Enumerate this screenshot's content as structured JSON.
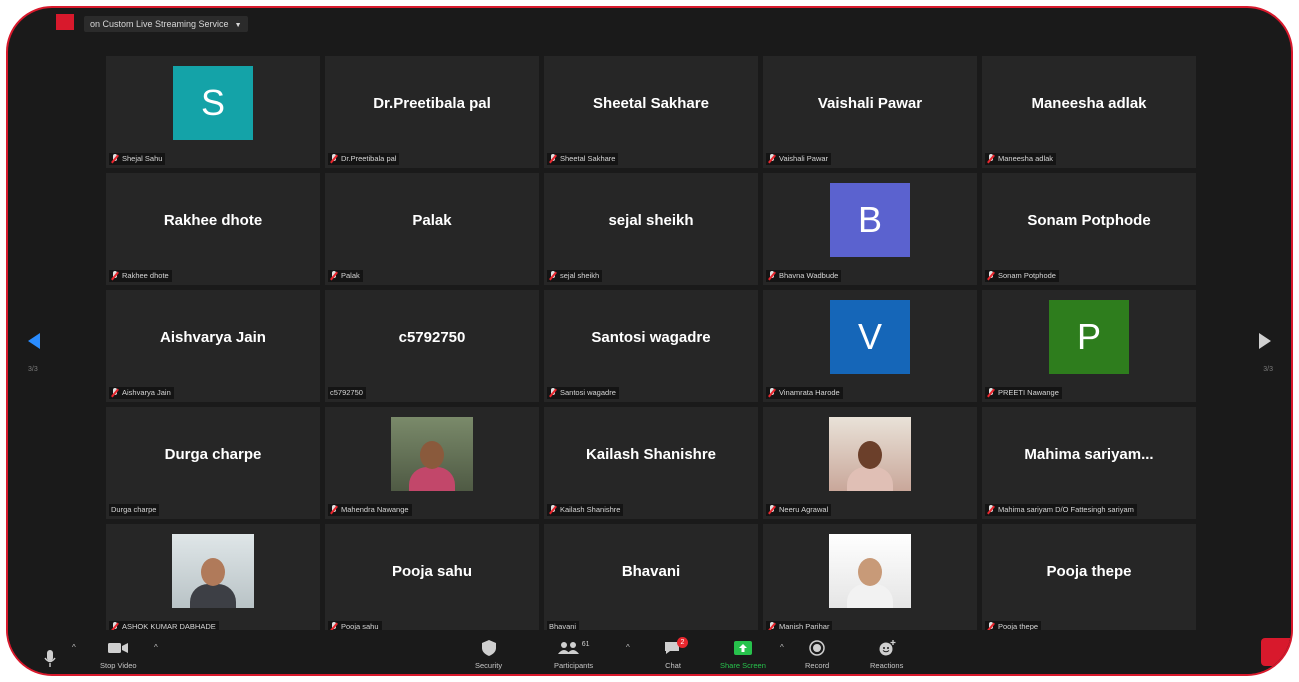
{
  "topbar": {
    "live_service": "on Custom Live Streaming Service"
  },
  "pagination": {
    "left": "3/3",
    "right": "3/3"
  },
  "tiles": [
    {
      "name": "Shejal Sahu",
      "kind": "avatar",
      "letter": "S",
      "color": "#14a3a8",
      "muted": true
    },
    {
      "name": "Dr.Preetibala pal",
      "kind": "name",
      "big": "Dr.Preetibala pal",
      "muted": true
    },
    {
      "name": "Sheetal Sakhare",
      "kind": "name",
      "big": "Sheetal Sakhare",
      "muted": true
    },
    {
      "name": "Vaishali Pawar",
      "kind": "name",
      "big": "Vaishali Pawar",
      "muted": true
    },
    {
      "name": "Maneesha adlak",
      "kind": "name",
      "big": "Maneesha adlak",
      "muted": true
    },
    {
      "name": "Rakhee dhote",
      "kind": "name",
      "big": "Rakhee dhote",
      "muted": true
    },
    {
      "name": "Palak",
      "kind": "name",
      "big": "Palak",
      "muted": true
    },
    {
      "name": "sejal sheikh",
      "kind": "name",
      "big": "sejal sheikh",
      "muted": true
    },
    {
      "name": "Bhavna Wadbude",
      "kind": "avatar",
      "letter": "B",
      "color": "#5b62cf",
      "muted": true
    },
    {
      "name": "Sonam Potphode",
      "kind": "name",
      "big": "Sonam Potphode",
      "muted": true
    },
    {
      "name": "Aishvarya Jain",
      "kind": "name",
      "big": "Aishvarya Jain",
      "muted": true
    },
    {
      "name": "c5792750",
      "kind": "name",
      "big": "c5792750",
      "muted": false
    },
    {
      "name": "Santosi wagadre",
      "kind": "name",
      "big": "Santosi wagadre",
      "muted": true
    },
    {
      "name": "Vinamrata Harode",
      "kind": "avatar",
      "letter": "V",
      "color": "#1566b8",
      "muted": true
    },
    {
      "name": "PREETI Nawange",
      "kind": "avatar",
      "letter": "P",
      "color": "#2e7d1d",
      "muted": true
    },
    {
      "name": "Durga charpe",
      "kind": "name",
      "big": "Durga charpe",
      "muted": false
    },
    {
      "name": "Mahendra Nawange",
      "kind": "photo",
      "photo": "outdoor",
      "muted": true
    },
    {
      "name": "Kailash Shanishre",
      "kind": "name",
      "big": "Kailash Shanishre",
      "muted": true
    },
    {
      "name": "Neeru Agrawal",
      "kind": "photo",
      "photo": "sofa",
      "muted": true
    },
    {
      "name": "Mahima sariyam D/O Fattesingh sariyam",
      "kind": "name",
      "big": "Mahima sariyam...",
      "muted": true
    },
    {
      "name": "ASHOK KUMAR DABHADE",
      "kind": "photo",
      "photo": "office",
      "muted": true
    },
    {
      "name": "Pooja sahu",
      "kind": "name",
      "big": "Pooja sahu",
      "muted": true
    },
    {
      "name": "Bhavani",
      "kind": "name",
      "big": "Bhavani",
      "muted": false
    },
    {
      "name": "Manish Parihar",
      "kind": "photo",
      "photo": "selfie",
      "muted": true
    },
    {
      "name": "Pooja thepe",
      "kind": "name",
      "big": "Pooja thepe",
      "muted": true
    }
  ],
  "toolbar": {
    "stop_video": "Stop Video",
    "security": "Security",
    "participants": "Participants",
    "participants_count": "61",
    "chat": "Chat",
    "chat_badge": "2",
    "share_screen": "Share Screen",
    "record": "Record",
    "reactions": "Reactions"
  },
  "colors": {
    "frame_border": "#d8192c",
    "background": "#1a1a1a",
    "tile": "#262626",
    "share_green": "#27c24c",
    "nav_blue": "#2a8cff"
  }
}
